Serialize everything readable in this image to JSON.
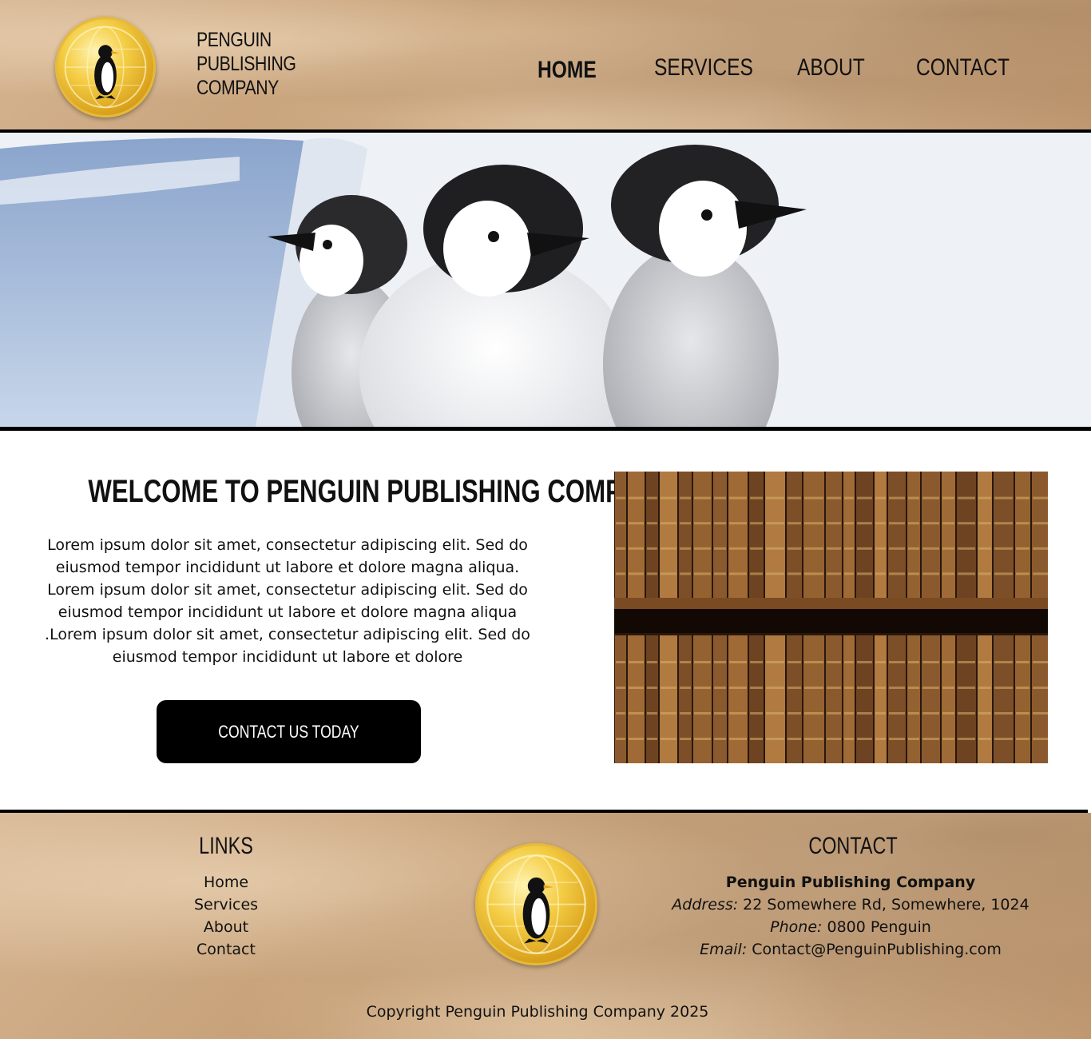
{
  "header": {
    "brand_lines": [
      "PENGUIN",
      "PUBLISHING",
      "COMPANY"
    ],
    "logo_icon": "penguin-globe-coin-icon",
    "nav": [
      {
        "label": "HOME",
        "active": true
      },
      {
        "label": "SERVICES",
        "active": false
      },
      {
        "label": "ABOUT",
        "active": false
      },
      {
        "label": "CONTACT",
        "active": false
      }
    ]
  },
  "main": {
    "title": "WELCOME TO PENGUIN PUBLISHING COMPANY",
    "body_lines": [
      "Lorem ipsum dolor sit amet, consectetur adipiscing elit. Sed do",
      "eiusmod tempor incididunt ut labore et dolore magna aliqua.",
      "Lorem ipsum dolor sit amet, consectetur adipiscing elit. Sed do",
      "eiusmod tempor incididunt ut labore et dolore magna aliqua",
      ".Lorem ipsum dolor sit amet, consectetur adipiscing elit. Sed do",
      "eiusmod tempor incididunt ut labore et dolore"
    ],
    "cta_label": "CONTACT US TODAY",
    "hero_image": "penguin-chicks-photo",
    "side_image": "bookshelf-photo"
  },
  "footer": {
    "links_heading": "LINKS",
    "links": [
      "Home",
      "Services",
      "About",
      "Contact"
    ],
    "contact_heading": "CONTACT",
    "company": "Penguin Publishing Company",
    "address_label": "Address:",
    "address": "22 Somewhere Rd, Somewhere, 1024",
    "phone_label": "Phone:",
    "phone": "0800 Penguin",
    "email_label": "Email:",
    "email": "Contact@PenguinPublishing.com",
    "copyright": "Copyright Penguin Publishing Company 2025"
  },
  "colors": {
    "paper": "#c9a57e",
    "ink": "#111111",
    "button": "#000000",
    "gold": "#f4cd45"
  }
}
